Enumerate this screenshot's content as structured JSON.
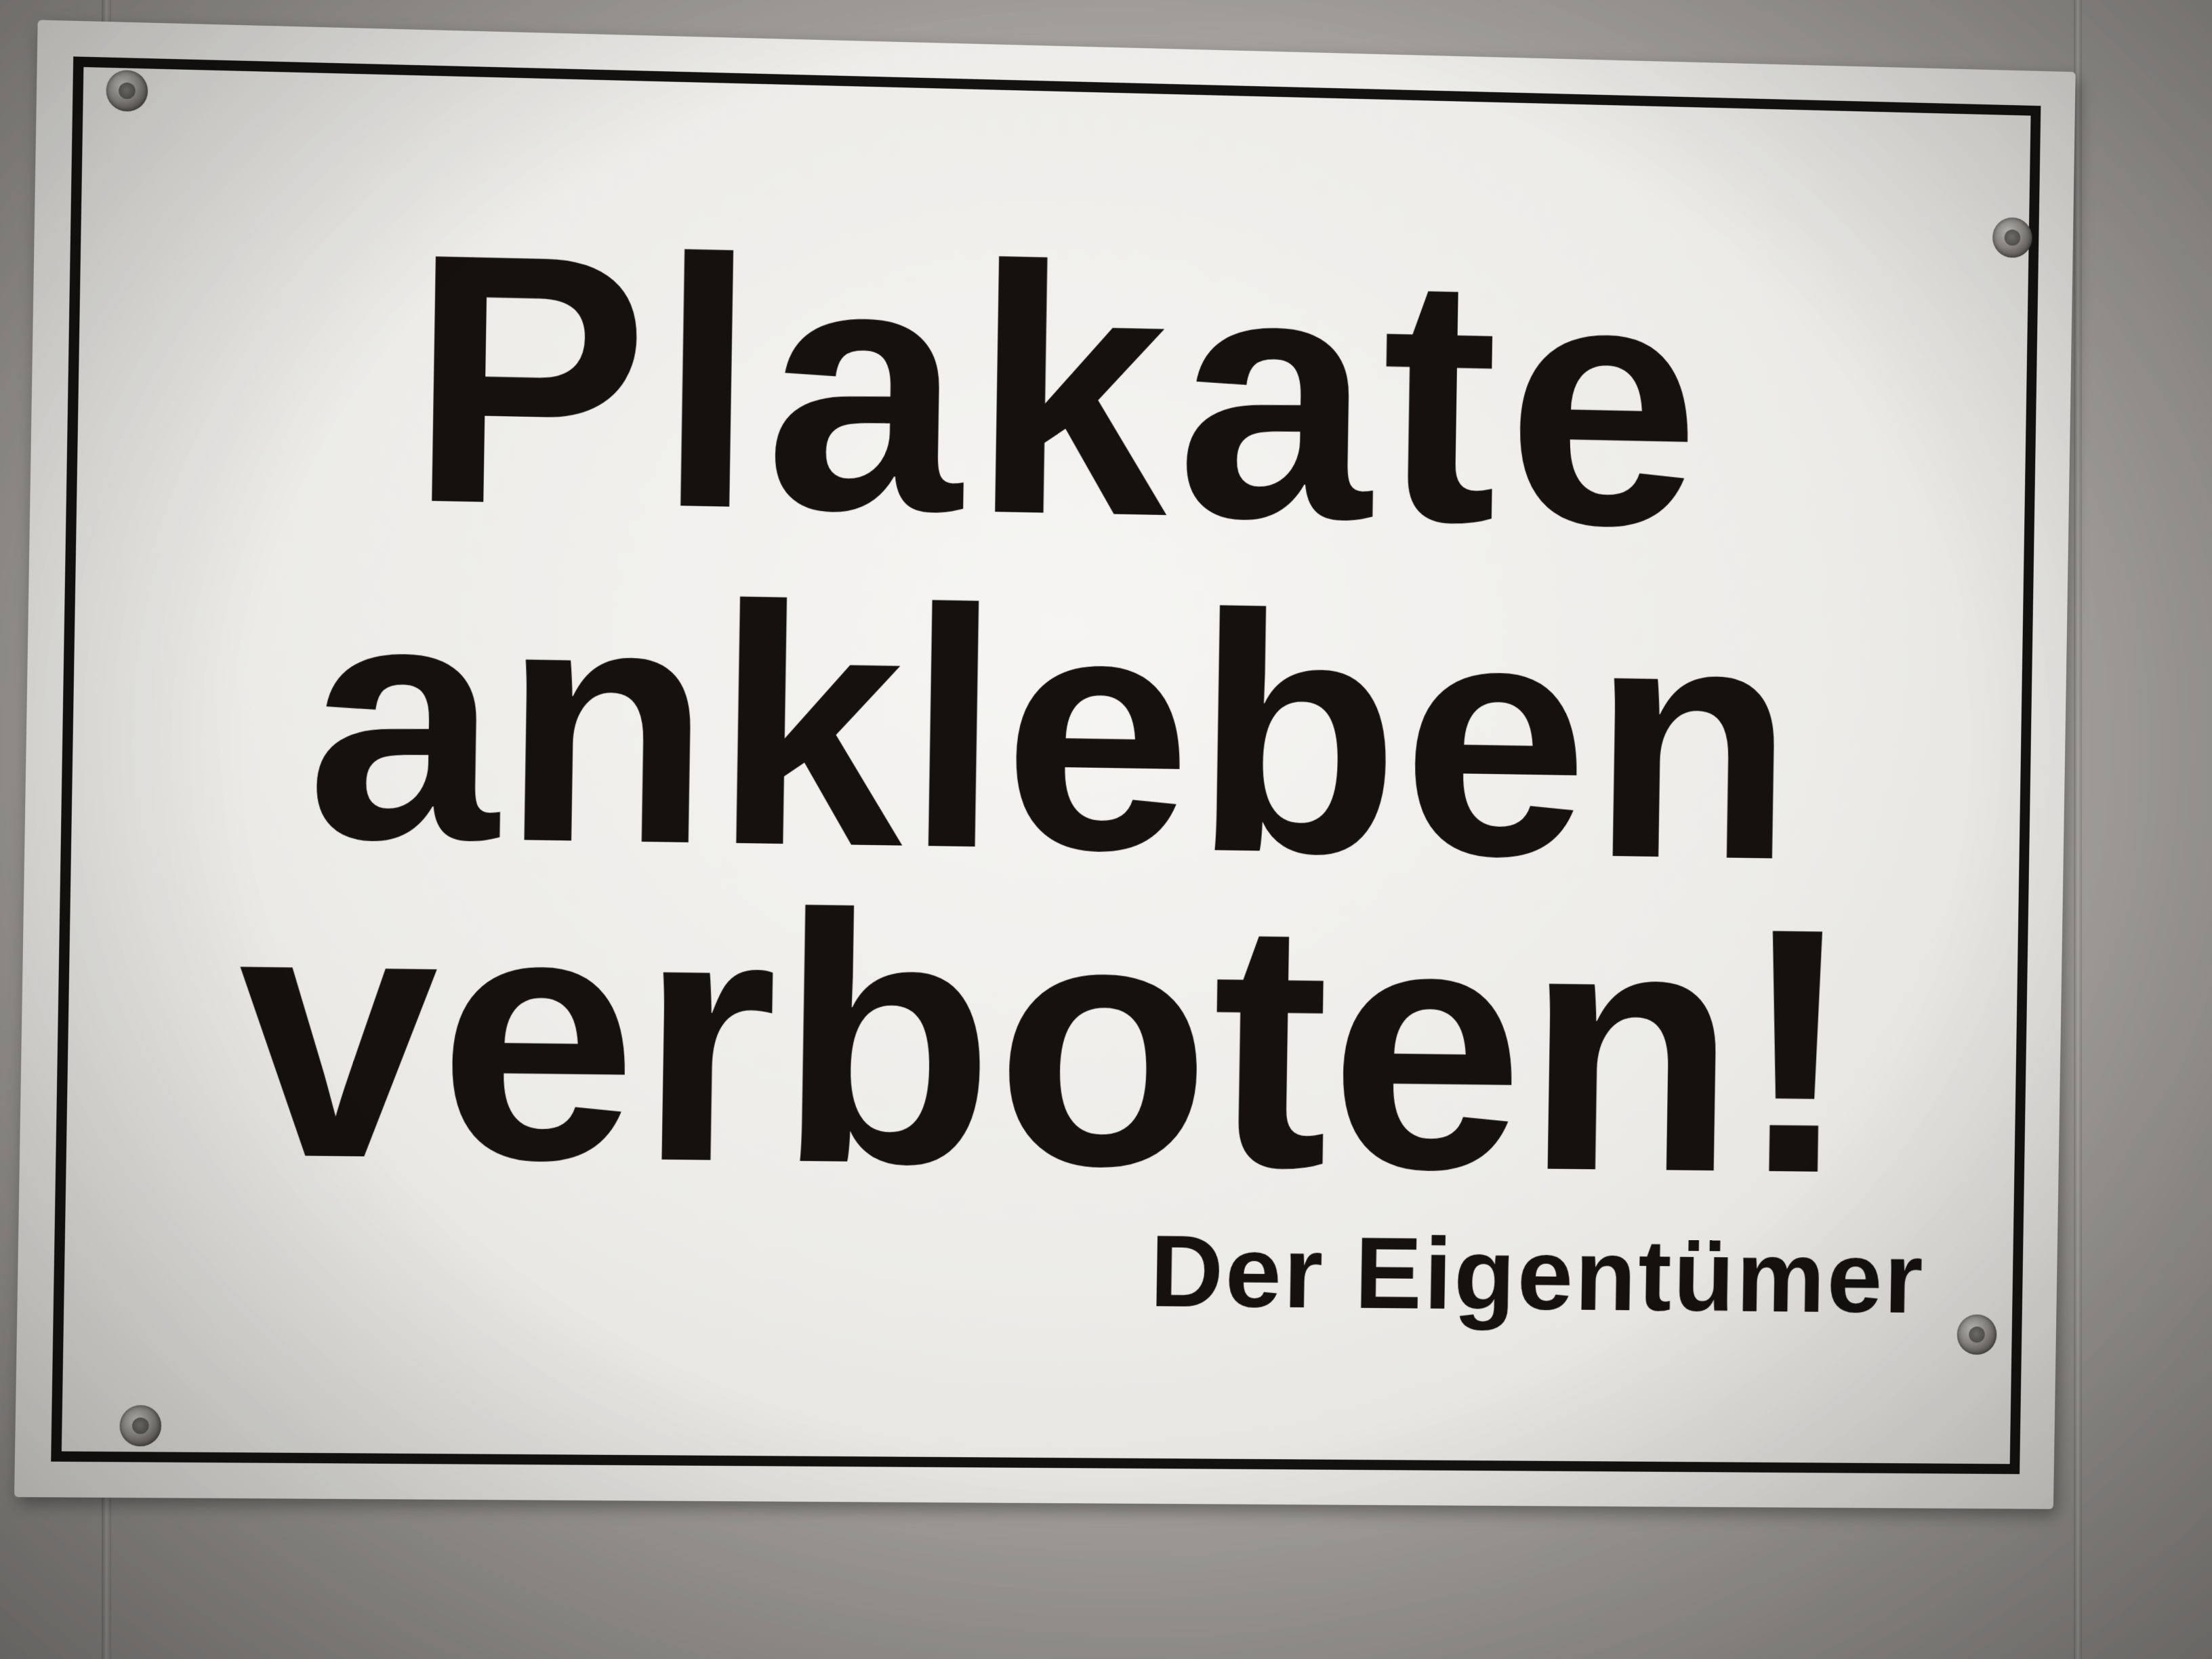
{
  "sign": {
    "line_1": "Plakate",
    "line_2": "ankleben",
    "line_3": "verboten!",
    "signature": "Der Eigentümer"
  },
  "colors": {
    "wall": "#a9a6a2",
    "plate": "#f2f1ee",
    "text": "#14110f",
    "border": "#141210"
  },
  "icons": {
    "mounting_screws": [
      "screw-icon",
      "screw-icon",
      "screw-icon",
      "screw-icon"
    ]
  }
}
